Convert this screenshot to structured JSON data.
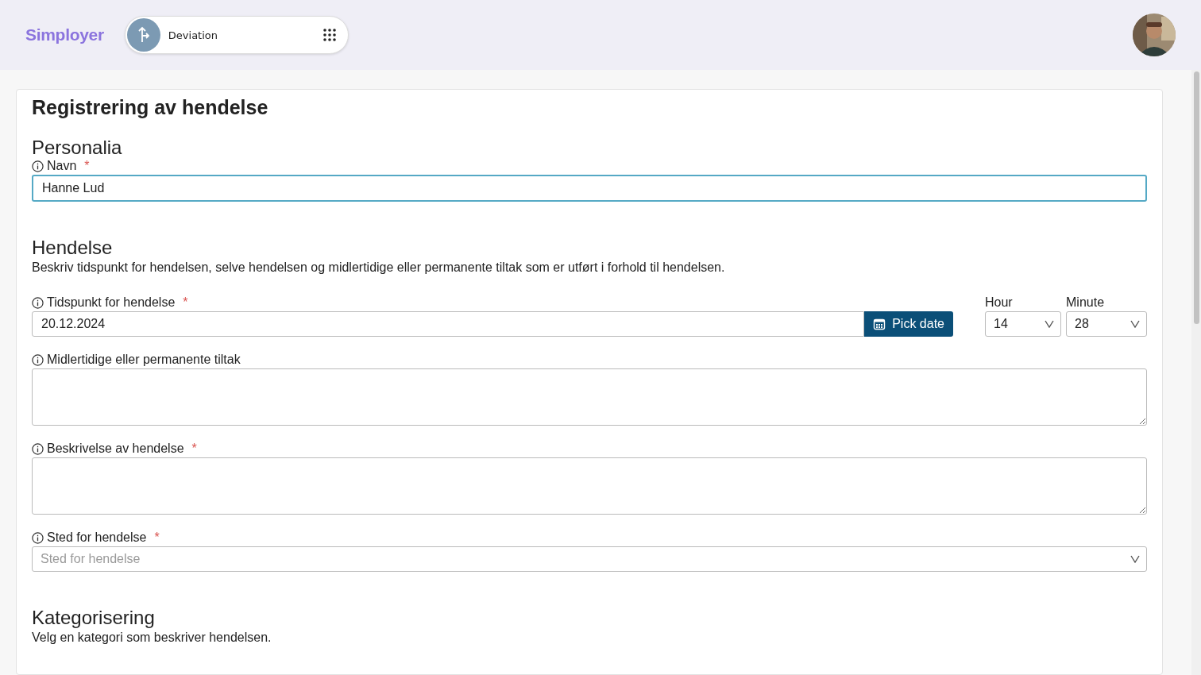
{
  "header": {
    "logo": "Simployer",
    "app_switcher": {
      "label": "Deviation"
    }
  },
  "form": {
    "title": "Registrering av hendelse",
    "sections": [
      {
        "heading": "Personalia",
        "fields": [
          {
            "kind": "text",
            "label": "Navn",
            "required_mark": "*",
            "value": "Hanne Lud",
            "focused": true
          }
        ]
      },
      {
        "heading": "Hendelse",
        "description": "Beskriv tidspunkt for hendelsen, selve hendelsen og midlertidige eller permanente tiltak som er utført i forhold til hendelsen.",
        "fields": [
          {
            "kind": "datetime",
            "label": "Tidspunkt for hendelse",
            "required_mark": "*",
            "value": "20.12.2024",
            "button": "Pick date",
            "hour": {
              "label": "Hour",
              "value": "14"
            },
            "minute": {
              "label": "Minute",
              "value": "28"
            }
          },
          {
            "kind": "textarea",
            "label": "Midlertidige eller permanente tiltak"
          },
          {
            "kind": "textarea",
            "label": "Beskrivelse av hendelse",
            "required_mark": "*"
          },
          {
            "kind": "select",
            "label": "Sted for hendelse",
            "required_mark": "*",
            "placeholder": "Sted for hendelse"
          }
        ]
      },
      {
        "heading": "Kategorisering",
        "description": "Velg en kategori som beskriver hendelsen."
      }
    ]
  }
}
